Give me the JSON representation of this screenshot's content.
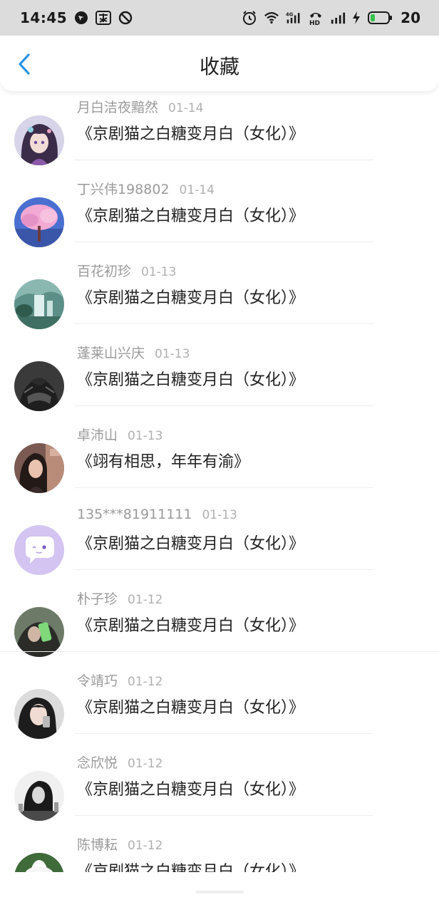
{
  "status_bar": {
    "time": "14:45",
    "battery": "20",
    "left_icons": [
      "navigation-app-icon",
      "app-notification-icon",
      "do-not-disturb-icon"
    ],
    "right_icons": [
      "alarm-icon",
      "wifi-icon",
      "4g-signal-icon",
      "hd-call-icon",
      "signal-icon",
      "charging-icon",
      "battery-icon"
    ]
  },
  "header": {
    "title": "收藏",
    "back_icon": "chevron-left-icon",
    "accent": "#2a95e8"
  },
  "items": [
    {
      "user": "月白洁夜黯然",
      "date": "01-14",
      "title": "《京剧猫之白糖变月白（女化）》",
      "avatar": "anime-girl"
    },
    {
      "user": "丁兴伟198802",
      "date": "01-14",
      "title": "《京剧猫之白糖变月白（女化）》",
      "avatar": "cherry-blossom-tree"
    },
    {
      "user": "百花初珍",
      "date": "01-13",
      "title": "《京剧猫之白糖变月白（女化）》",
      "avatar": "waterfall-landscape"
    },
    {
      "user": "蓬莱山兴庆",
      "date": "01-13",
      "title": "《京剧猫之白糖变月白（女化）》",
      "avatar": "person-black-jacket"
    },
    {
      "user": "卓沛山",
      "date": "01-13",
      "title": "《翊有相思，年年有渝》",
      "avatar": "woman-photo"
    },
    {
      "user": "135***81911111",
      "date": "01-13",
      "title": "《京剧猫之白糖变月白（女化）》",
      "avatar": "default-chat-bubble"
    },
    {
      "user": "朴子珍",
      "date": "01-12",
      "title": "《京剧猫之白糖变月白（女化）》",
      "avatar": "person-green-phone"
    },
    {
      "user": "令靖巧",
      "date": "01-12",
      "title": "《京剧猫之白糖变月白（女化）》",
      "avatar": "woman-black-hair"
    },
    {
      "user": "念欣悦",
      "date": "01-12",
      "title": "《京剧猫之白糖变月白（女化）》",
      "avatar": "woman-monochrome"
    },
    {
      "user": "陈博耘",
      "date": "01-12",
      "title": "《京剧猫之白糖变月白（女化）》",
      "avatar": "white-flower"
    }
  ]
}
